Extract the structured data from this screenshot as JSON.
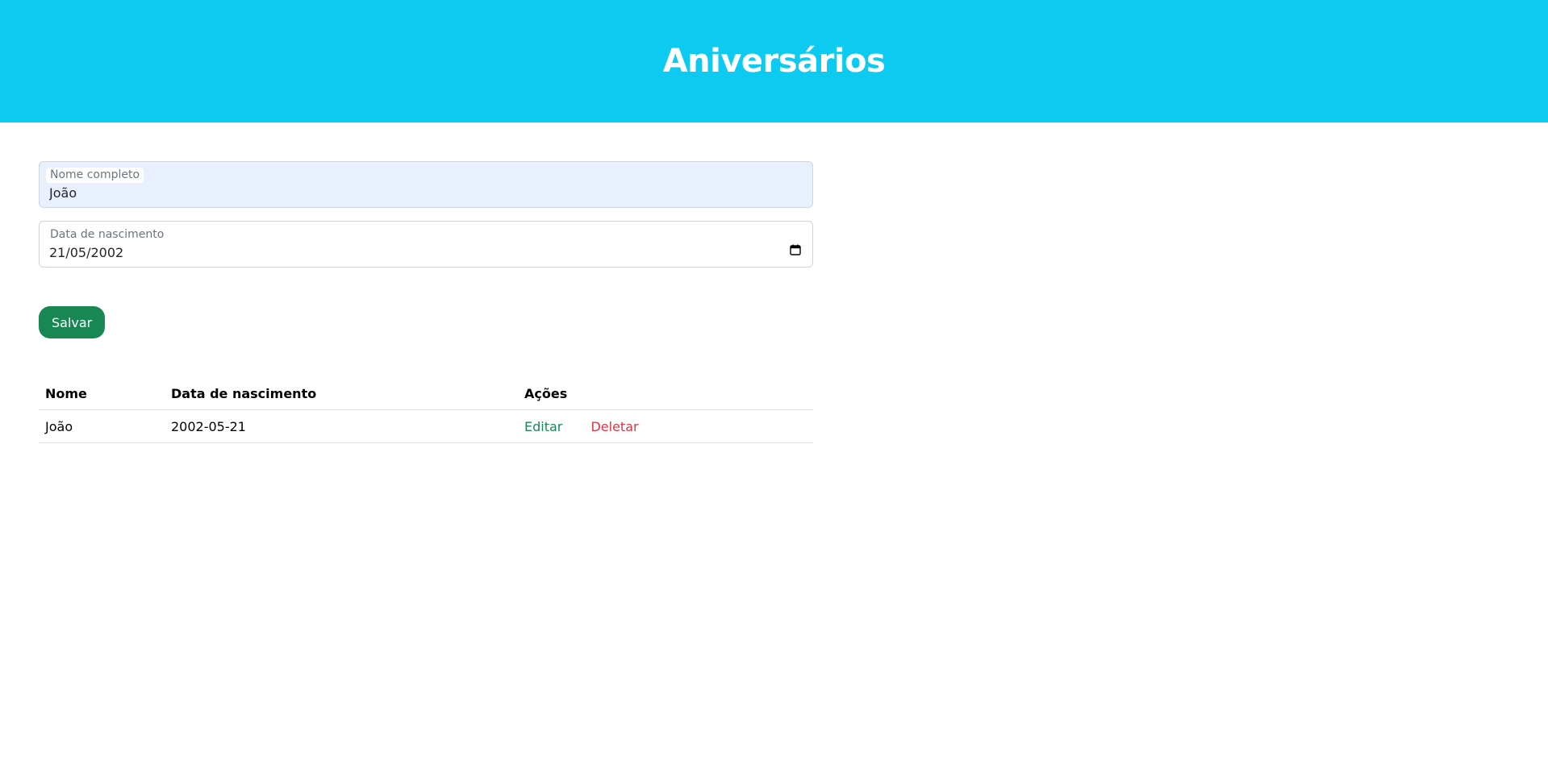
{
  "header": {
    "title": "Aniversários",
    "background_color": "#0dcaf0"
  },
  "form": {
    "name_field": {
      "label": "Nome completo",
      "value": "João"
    },
    "date_field": {
      "label": "Data de nascimento",
      "value": "21/05/2002",
      "icon": "calendar-icon"
    },
    "save_label": "Salvar",
    "save_color": "#198754"
  },
  "table": {
    "headers": [
      "Nome",
      "Data de nascimento",
      "Ações"
    ],
    "rows": [
      {
        "nome": "João",
        "data": "2002-05-21",
        "edit_label": "Editar",
        "delete_label": "Deletar"
      }
    ],
    "edit_color": "#198754",
    "delete_color": "#dc3545"
  }
}
